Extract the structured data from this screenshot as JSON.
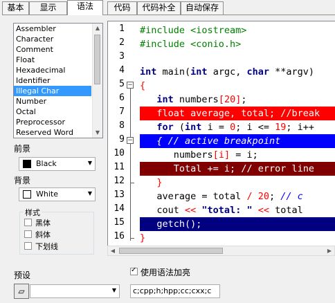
{
  "tabs": [
    {
      "label": "基本",
      "active": false
    },
    {
      "label": "显示",
      "active": false
    },
    {
      "label": "语法",
      "active": true
    },
    {
      "label": "代码",
      "active": false
    },
    {
      "label": "代码补全",
      "active": false
    },
    {
      "label": "自动保存",
      "active": false
    }
  ],
  "elements_list": {
    "items": [
      "Assembler",
      "Character",
      "Comment",
      "Float",
      "Hexadecimal",
      "Identifier",
      "Illegal Char",
      "Number",
      "Octal",
      "Preprocessor",
      "Reserved Word"
    ],
    "selected": "Illegal Char"
  },
  "foreground": {
    "label": "前景",
    "value": "Black",
    "swatch": "#000000"
  },
  "background": {
    "label": "背景",
    "value": "White",
    "swatch": "#ffffff"
  },
  "style_group": {
    "title": "样式",
    "options": [
      {
        "label": "黑体",
        "checked": false
      },
      {
        "label": "斜体",
        "checked": false
      },
      {
        "label": "下划线",
        "checked": false
      }
    ]
  },
  "editor": {
    "line_numbers": [
      "1",
      "2",
      "3",
      "4",
      "5",
      "6",
      "7",
      "8",
      "9",
      "10",
      "11",
      "12",
      "13",
      "14",
      "15",
      "16"
    ],
    "lines": {
      "l1_pre": "#include <iostream>",
      "l2_pre": "#include <conio.h>",
      "l4_kw1": "int",
      "l4_t1": " main(",
      "l4_kw2": "int",
      "l4_t2": " argc, ",
      "l4_kw3": "char",
      "l4_t3": " **argv)",
      "l5": "{",
      "l6_kw": "int",
      "l6_t": " numbers",
      "l6_b": "[20]",
      "l6_e": ";",
      "l7": "float average, total; //break",
      "l8_kw": "for",
      "l8_t1": " (",
      "l8_kw2": "int",
      "l8_t2": " i = ",
      "l8_n1": "0",
      "l8_t3": "; i <= ",
      "l8_n2": "19",
      "l8_t4": "; i++",
      "l9": "{ // active breakpoint",
      "l10_t": "numbers",
      "l10_b": "[i]",
      "l10_e": " = i;",
      "l11": "Total += i; // error line",
      "l12": "}",
      "l13_t1": "average = total ",
      "l13_op": "/",
      "l13_n": " 20",
      "l13_t2": "; ",
      "l13_c": "// c",
      "l14_t1": "cout ",
      "l14_op1": "<<",
      "l14_s": " \"total: \"",
      "l14_op2": " <<",
      "l14_t2": " total",
      "l15": "getch();",
      "l16": "}"
    },
    "colors": {
      "breakpoint": "#ff0000",
      "active_breakpoint": "#0000ff",
      "error_line": "#800000",
      "current_line": "#000080"
    }
  },
  "preset": {
    "label": "预设"
  },
  "enhance": {
    "label": "使用语法加亮",
    "checked": true
  },
  "extensions": {
    "value": "c;cpp;h;hpp;cc;cxx;c"
  }
}
